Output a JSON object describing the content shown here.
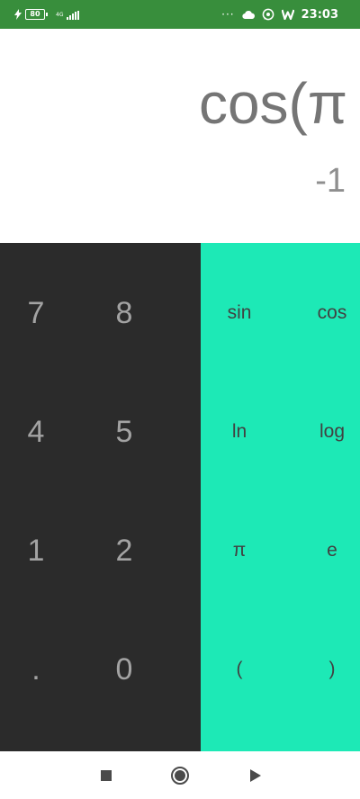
{
  "status_bar": {
    "battery": "80",
    "network": "4G",
    "time": "23:03",
    "dots": "···",
    "icons": [
      "charging-icon",
      "battery-icon",
      "signal-icon",
      "cloud-icon",
      "whatsapp-icon",
      "w-app-icon"
    ]
  },
  "display": {
    "expression": "cos(π",
    "result": "-1"
  },
  "numpad": {
    "keys": [
      "7",
      "8",
      "4",
      "5",
      "1",
      "2",
      ".",
      "0"
    ]
  },
  "advanced": {
    "keys": [
      "sin",
      "cos",
      "ln",
      "log",
      "π",
      "e",
      "(",
      ")"
    ]
  },
  "nav_bar": {
    "icons": [
      "recents-square-icon",
      "home-circle-icon",
      "back-triangle-icon"
    ]
  },
  "colors": {
    "status_bar": "#388e3c",
    "numpad_bg": "#2b2b2b",
    "advanced_bg": "#1de9b6",
    "expression_text": "#757575"
  }
}
